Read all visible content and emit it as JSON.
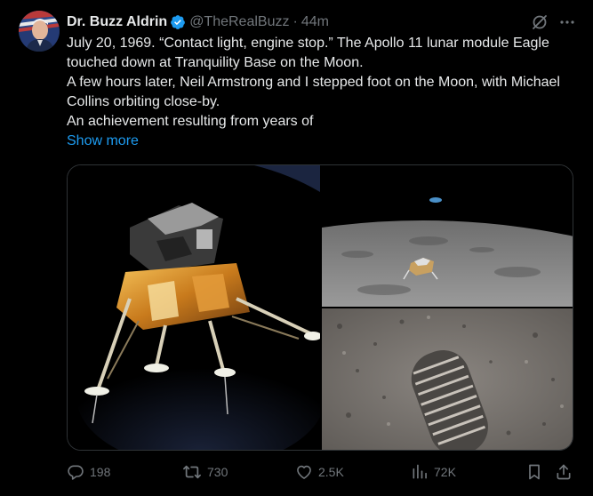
{
  "author": {
    "name": "Dr. Buzz Aldrin",
    "handle": "@TheRealBuzz",
    "separator": "·",
    "time": "44m"
  },
  "post": {
    "line1": "July 20, 1969. “Contact light, engine stop.” The Apollo 11 lunar module Eagle touched down at Tranquility Base on the Moon.",
    "line2": "A few hours later, Neil Armstrong and I stepped foot on the Moon, with Michael Collins orbiting close-by.",
    "line3": "An achievement resulting from years of",
    "show_more": "Show more"
  },
  "actions": {
    "replies": "198",
    "reposts": "730",
    "likes": "2.5K",
    "views": "72K"
  },
  "icons": {
    "verified": "verified-badge-icon",
    "grok": "grok-icon",
    "more": "more-icon",
    "reply": "reply-icon",
    "repost": "repost-icon",
    "like": "like-icon",
    "views": "views-icon",
    "bookmark": "bookmark-icon",
    "share": "share-icon"
  },
  "colors": {
    "background": "#000000",
    "text": "#e7e9ea",
    "secondary": "#71767b",
    "link": "#1d9bf0",
    "border": "#2f3336"
  }
}
